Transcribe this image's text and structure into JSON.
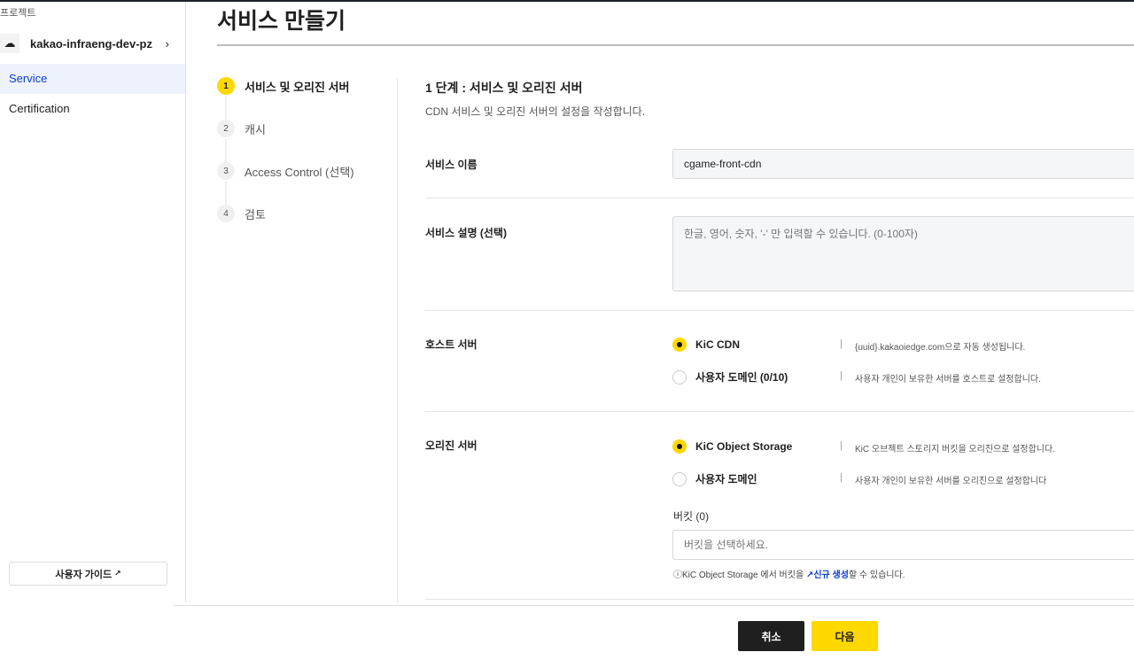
{
  "sidebar": {
    "project_label": "프로젝트",
    "project_name": "kakao-infraeng-dev-pz",
    "items": [
      {
        "label": "Service",
        "active": true
      },
      {
        "label": "Certification",
        "active": false
      }
    ],
    "guide_label": "사용자 가이드"
  },
  "page": {
    "title": "서비스 만들기"
  },
  "steps": [
    {
      "num": "1",
      "label": "서비스 및 오리진 서버",
      "active": true
    },
    {
      "num": "2",
      "label": "캐시"
    },
    {
      "num": "3",
      "label": "Access Control (선택)"
    },
    {
      "num": "4",
      "label": "검토"
    }
  ],
  "form": {
    "heading": "1 단계 : 서비스 및 오리진 서버",
    "subheading": "CDN 서비스 및 오리진 서버의 설정을 작성합니다.",
    "service_name": {
      "label": "서비스 이름",
      "value": "cgame-front-cdn"
    },
    "service_desc": {
      "label": "서비스 설명 (선택)",
      "placeholder": "한글, 영어, 숫자, '-' 만 입력할 수 있습니다. (0-100자)"
    },
    "host": {
      "label": "호스트 서버",
      "options": [
        {
          "label": "KiC CDN",
          "desc": "{uuid}.kakaoiedge.com으로 자동 생성됩니다.",
          "selected": true
        },
        {
          "label": "사용자 도메인 (0/10)",
          "desc": "사용자 개인이 보유한 서버를 호스트로 설정합니다.",
          "selected": false
        }
      ]
    },
    "origin": {
      "label": "오리진 서버",
      "options": [
        {
          "label": "KiC Object Storage",
          "desc": "KiC 오브젝트 스토리지 버킷을 오리진으로 설정합니다.",
          "selected": true
        },
        {
          "label": "사용자 도메인",
          "desc": "사용자 개인이 보유한 서버를 오리진으로 설정합니다",
          "selected": false
        }
      ]
    },
    "bucket": {
      "label": "버킷 (0)",
      "placeholder": "버킷을 선택하세요.",
      "help_prefix": "KiC Object Storage 에서 버킷을",
      "help_link": "신규 생성",
      "help_suffix": "할 수 있습니다."
    },
    "separator": "|"
  },
  "footer": {
    "cancel": "취소",
    "next": "다음"
  },
  "colors": {
    "accent": "#ffd800",
    "link": "#0b3ccf",
    "dark_button": "#1f1f1f"
  }
}
